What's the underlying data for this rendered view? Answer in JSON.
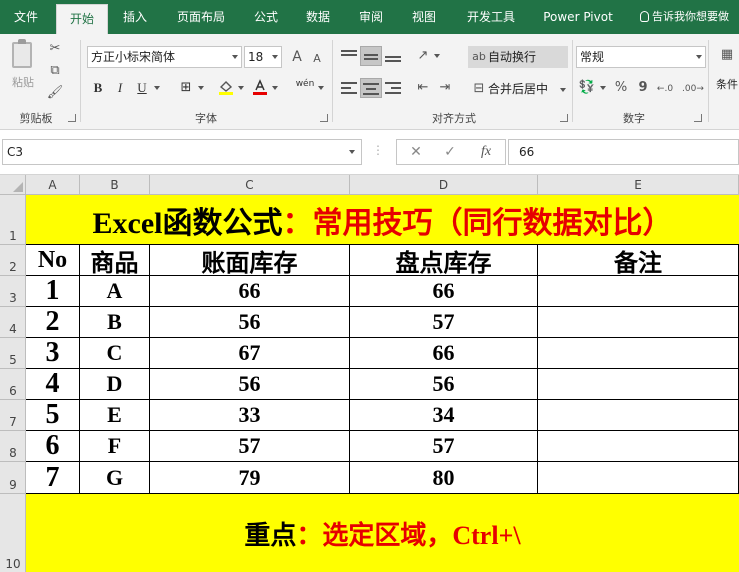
{
  "ribbon_tabs": [
    "文件",
    "开始",
    "插入",
    "页面布局",
    "公式",
    "数据",
    "审阅",
    "视图",
    "开发工具",
    "Power Pivot"
  ],
  "tell_me": "告诉我你想要做",
  "clipboard": {
    "paste_label": "粘贴",
    "group_label": "剪贴板"
  },
  "font": {
    "name": "方正小标宋简体",
    "size": "18",
    "grow_label": "A",
    "shrink_label": "A",
    "bold_label": "B",
    "italic_label": "I",
    "underline_label": "U",
    "phonetic_label": "wén",
    "group_label": "字体"
  },
  "alignment": {
    "wrap_text": "自动换行",
    "merge_center": "合并后居中",
    "group_label": "对齐方式"
  },
  "number": {
    "format": "常规",
    "percent_label": "%",
    "comma_label": "9",
    "group_label": "数字"
  },
  "styles": {
    "conditional_label": "条件"
  },
  "formula_bar": {
    "name_box": "C3",
    "fx_label": "fx",
    "value": "66"
  },
  "sheet": {
    "columns": [
      "A",
      "B",
      "C",
      "D",
      "E"
    ],
    "rows": [
      "1",
      "2",
      "3",
      "4",
      "5",
      "6",
      "7",
      "8",
      "9",
      "10"
    ],
    "title_black": "Excel函数公式",
    "title_red": "：常用技巧（同行数据对比）",
    "headers": [
      "No",
      "商品",
      "账面库存",
      "盘点库存",
      "备注"
    ],
    "data": [
      [
        "1",
        "A",
        "66",
        "66",
        ""
      ],
      [
        "2",
        "B",
        "56",
        "57",
        ""
      ],
      [
        "3",
        "C",
        "67",
        "66",
        ""
      ],
      [
        "4",
        "D",
        "56",
        "56",
        ""
      ],
      [
        "5",
        "E",
        "33",
        "34",
        ""
      ],
      [
        "6",
        "F",
        "57",
        "57",
        ""
      ],
      [
        "7",
        "G",
        "79",
        "80",
        ""
      ]
    ],
    "footer_black": "重点",
    "footer_red": "：选定区域，Ctrl+\\"
  },
  "colors": {
    "ribbon_green": "#217346",
    "highlight_yellow": "#ffff00",
    "title_red": "#e60000"
  }
}
